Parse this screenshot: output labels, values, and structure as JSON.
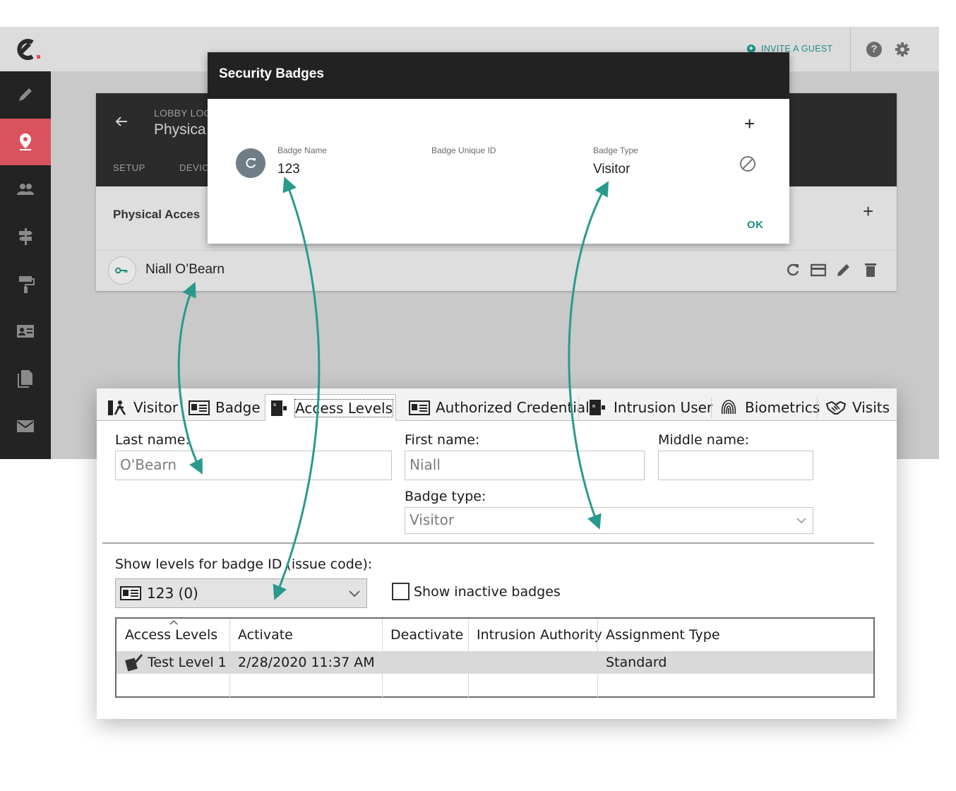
{
  "colors": {
    "accent": "#1f8e83",
    "sidebar_active": "#d9535e",
    "dark": "#222222"
  },
  "webapp": {
    "invite_label": "INVITE A GUEST",
    "card": {
      "subtitle": "LOBBY LOC",
      "title": "Physica",
      "tabs": [
        "SETUP",
        "DEVIC"
      ],
      "section_title": "Physical Acces",
      "person_name": "Niall O’Bearn"
    },
    "sidebar_icons": [
      "pencil-icon",
      "location-pin-icon",
      "people-icon",
      "signpost-icon",
      "paint-roller-icon",
      "id-card-icon",
      "documents-icon",
      "mail-icon"
    ]
  },
  "modal": {
    "title": "Security Badges",
    "columns": {
      "name": "Badge Name",
      "unique_id": "Badge Unique ID",
      "type": "Badge Type"
    },
    "badge": {
      "name": "123",
      "unique_id": "",
      "type": "Visitor"
    },
    "ok_label": "OK"
  },
  "desktop": {
    "tabs": [
      "Visitor",
      "Badge",
      "Access Levels",
      "Authorized Credential",
      "Intrusion User",
      "Biometrics",
      "Visits"
    ],
    "active_tab": "Access Levels",
    "fields": {
      "last_name_label": "Last name:",
      "last_name": "O'Bearn",
      "first_name_label": "First name:",
      "first_name": "Niall",
      "middle_name_label": "Middle name:",
      "middle_name": "",
      "badge_type_label": "Badge type:",
      "badge_type": "Visitor"
    },
    "levels_label": "Show levels for badge ID (issue code):",
    "levels_value": "123 (0)",
    "show_inactive_label": "Show inactive badges",
    "show_inactive_checked": false,
    "grid": {
      "columns": [
        "Access Levels",
        "Activate",
        "Deactivate",
        "Intrusion Authority",
        "Assignment Type"
      ],
      "rows": [
        {
          "level": "Test Level 1",
          "activate": "2/28/2020 11:37 AM",
          "deactivate": "",
          "intrusion_authority": "",
          "assignment_type": "Standard"
        }
      ]
    }
  }
}
